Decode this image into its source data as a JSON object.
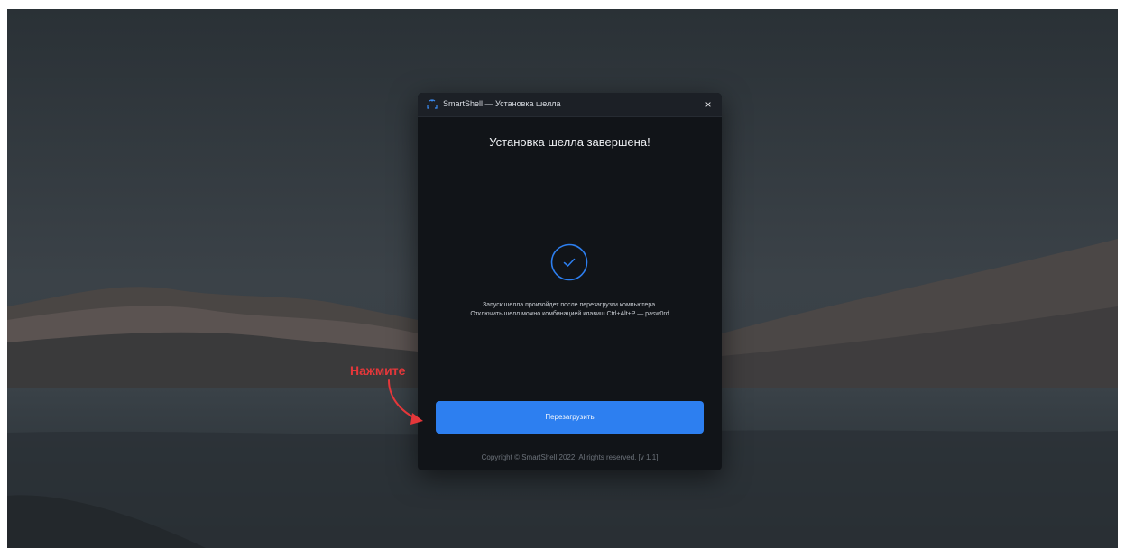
{
  "window": {
    "title": "SmartShell — Установка шелла",
    "close_glyph": "×"
  },
  "content": {
    "heading": "Установка шелла завершена!",
    "message_line1": "Запуск шелла произойдет после перезагрузки компьютера.",
    "message_line2": "Отключить шелл можно комбинацией клавиш Ctrl+Alt+P — pasw0rd",
    "status_icon": "check-circle-icon"
  },
  "actions": {
    "reboot_label": "Перезагрузить"
  },
  "footer": {
    "copyright": "Copyright © SmartShell 2022. Allrights reserved. [v 1.1]"
  },
  "annotation": {
    "text": "Нажмите",
    "color": "#e5373a"
  },
  "colors": {
    "accent": "#2d7ff0",
    "window_bg": "#111418",
    "titlebar_bg": "#1c2026"
  }
}
